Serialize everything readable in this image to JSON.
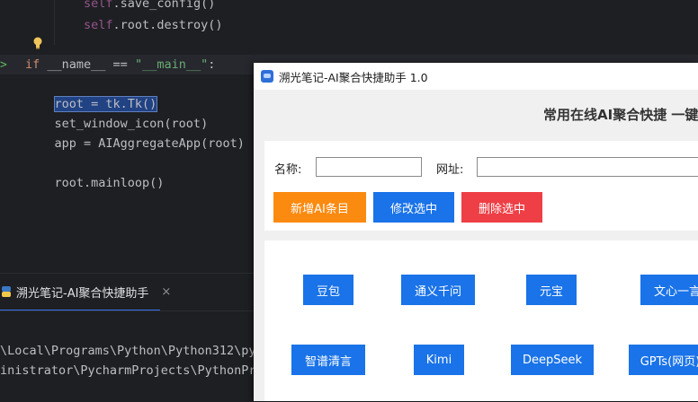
{
  "editor": {
    "lines": [
      {
        "parts": [
          {
            "t": "        ",
            "c": ""
          },
          {
            "t": "self",
            "c": "self"
          },
          {
            "t": ".save_config()",
            "c": "fn"
          }
        ]
      },
      {
        "parts": [
          {
            "t": "        ",
            "c": ""
          },
          {
            "t": "self",
            "c": "self"
          },
          {
            "t": ".root.destroy()",
            "c": "fn"
          }
        ]
      },
      {
        "parts": [
          {
            "t": "",
            "c": ""
          }
        ]
      },
      {
        "parts": [
          {
            "t": "if",
            "c": "kw"
          },
          {
            "t": " __name__ == ",
            "c": "fn"
          },
          {
            "t": "\"__main__\"",
            "c": "str"
          },
          {
            "t": ":",
            "c": "fn"
          }
        ]
      },
      {
        "parts": [
          {
            "t": "",
            "c": ""
          }
        ]
      },
      {
        "parts": [
          {
            "t": "    ",
            "c": ""
          },
          {
            "t": "root = tk.Tk()",
            "c": "sel"
          }
        ]
      },
      {
        "parts": [
          {
            "t": "    set_window_icon(root)",
            "c": "fn"
          }
        ]
      },
      {
        "parts": [
          {
            "t": "    app = AIAggregateApp(root)",
            "c": "fn"
          }
        ]
      },
      {
        "parts": [
          {
            "t": "",
            "c": ""
          }
        ]
      },
      {
        "parts": [
          {
            "t": "    root.mainloop()",
            "c": "fn"
          }
        ]
      }
    ],
    "run_marker": ">"
  },
  "run_panel": {
    "tab_label": "溯光笔记-AI聚合快捷助手",
    "close_glyph": "×",
    "console_lines": [
      "\\Local\\Programs\\Python\\Python312\\py",
      "inistrator\\PycharmProjects\\PythonPr"
    ]
  },
  "app": {
    "window_title": "溯光笔记-AI聚合快捷助手 1.0",
    "heading": "常用在线AI聚合快捷 一键",
    "form": {
      "name_label": "名称:",
      "url_label": "网址:",
      "name_value": "",
      "url_value": ""
    },
    "actions": [
      {
        "label": "新增AI条目",
        "color": "#fb8a10"
      },
      {
        "label": "修改选中",
        "color": "#1a73e8"
      },
      {
        "label": "删除选中",
        "color": "#ee3f46"
      }
    ],
    "ai_items": [
      {
        "label": "豆包"
      },
      {
        "label": "通义千问"
      },
      {
        "label": "元宝"
      },
      {
        "label": "文心一言"
      },
      {
        "label": "智谱清言"
      },
      {
        "label": "Kimi"
      },
      {
        "label": "DeepSeek"
      },
      {
        "label": "GPTs(网页)"
      }
    ],
    "accent_color": "#1a73e8"
  }
}
